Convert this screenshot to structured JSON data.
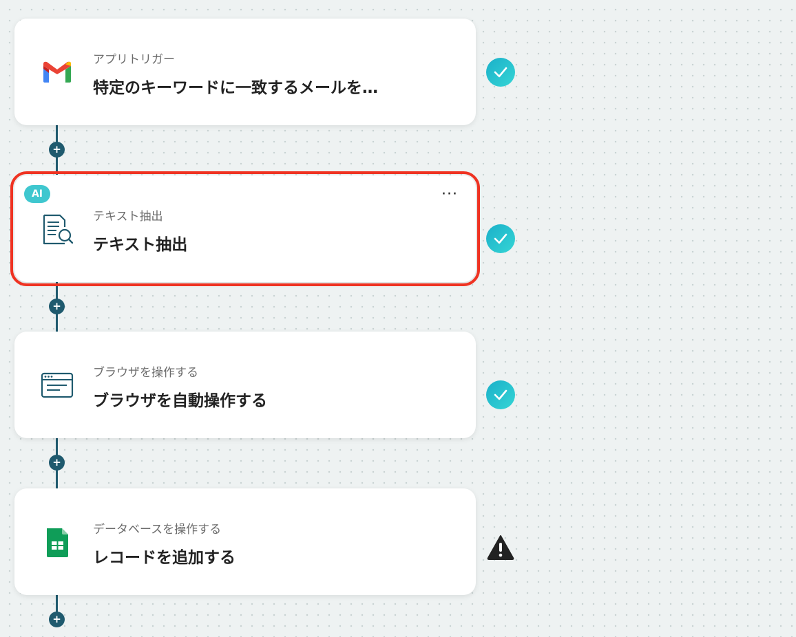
{
  "steps": [
    {
      "category": "アプリトリガー",
      "title": "特定のキーワードに一致するメールを…",
      "icon": "gmail-icon",
      "status": "complete"
    },
    {
      "category": "テキスト抽出",
      "title": "テキスト抽出",
      "icon": "document-search-icon",
      "badge": "AI",
      "status": "complete",
      "selected": true
    },
    {
      "category": "ブラウザを操作する",
      "title": "ブラウザを自動操作する",
      "icon": "browser-window-icon",
      "status": "complete"
    },
    {
      "category": "データベースを操作する",
      "title": "レコードを追加する",
      "icon": "google-sheets-icon",
      "status": "warning"
    }
  ],
  "add_step_symbol": "+",
  "more_symbol": "···",
  "colors": {
    "connector": "#1f5a6e",
    "check": "#27c3d0",
    "highlight": "#ef3322",
    "ai_badge": "#3fc7cf"
  }
}
